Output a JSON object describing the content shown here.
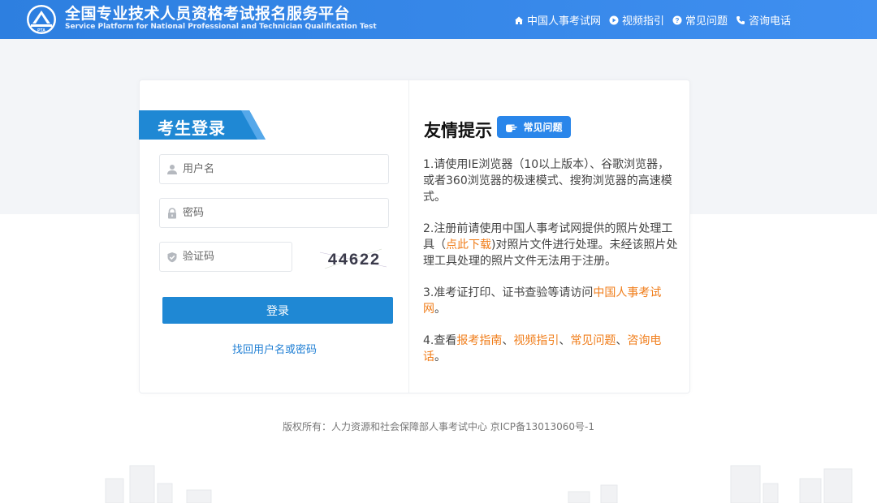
{
  "header": {
    "title": "全国专业技术人员资格考试报名服务平台",
    "subtitle": "Service Platform for National Professional and Technician Qualification Test",
    "logo_text": "PTA",
    "nav": [
      {
        "label": "中国人事考试网",
        "icon": "home-icon"
      },
      {
        "label": "视频指引",
        "icon": "play-icon"
      },
      {
        "label": "常见问题",
        "icon": "question-icon"
      },
      {
        "label": "咨询电话",
        "icon": "phone-icon"
      }
    ]
  },
  "login": {
    "title": "考生登录",
    "username_placeholder": "用户名",
    "password_placeholder": "密码",
    "captcha_placeholder": "验证码",
    "captcha_text": "44622",
    "submit_label": "登录",
    "forgot_label": "找回用户名或密码"
  },
  "tips": {
    "title": "友情提示",
    "faq_badge": "常见问题",
    "item1": "1.请使用IE浏览器（10以上版本）、谷歌浏览器，或者360浏览器的极速模式、搜狗浏览器的高速模式。",
    "item2_pre": "2.注册前请使用中国人事考试网提供的照片处理工具（",
    "item2_link": "点此下载",
    "item2_post": ")对照片文件进行处理。未经该照片处理工具处理的照片文件无法用于注册。",
    "item3_pre": "3.准考证打印、证书查验等请访问",
    "item3_link": "中国人事考试网",
    "item3_post": "。",
    "item4_pre": "4.查看",
    "item4_link1": "报考指南",
    "sep": "、",
    "item4_link2": "视频指引",
    "item4_link3": "常见问题",
    "item4_link4": "咨询电话",
    "item4_post": "。"
  },
  "footer": {
    "copyright": "版权所有：人力资源和社会保障部人事考试中心 京ICP备13013060号-1"
  },
  "colors": {
    "header_blue": "#2d7fe0",
    "button_blue": "#1f88d4",
    "link_orange": "#f07d1a"
  }
}
